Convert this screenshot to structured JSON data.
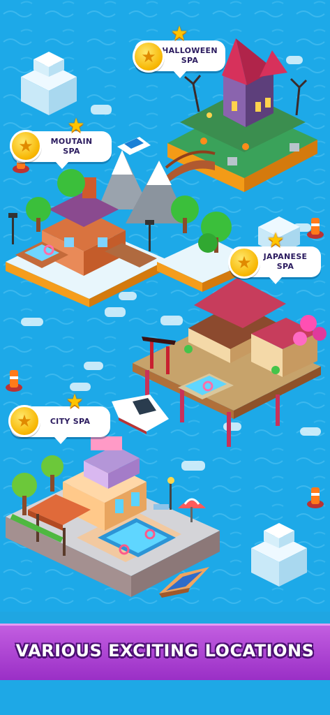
{
  "locations": [
    {
      "id": "halloween",
      "name": "HALLOWEEN\nSPA"
    },
    {
      "id": "moutain",
      "name": "MOUTAIN\nSPA"
    },
    {
      "id": "japanese",
      "name": "JAPANESE\nSPA"
    },
    {
      "id": "city",
      "name": "CITY SPA"
    }
  ],
  "banner": {
    "text": "VARIOUS EXCITING LOCATIONS"
  },
  "icons": {
    "coin": "star-coin-icon",
    "star": "star-icon"
  },
  "colors": {
    "water": "#1da9e8",
    "banner": "#b04ad8",
    "coin": "#f7b500",
    "accent_roof": "#d7315b"
  }
}
